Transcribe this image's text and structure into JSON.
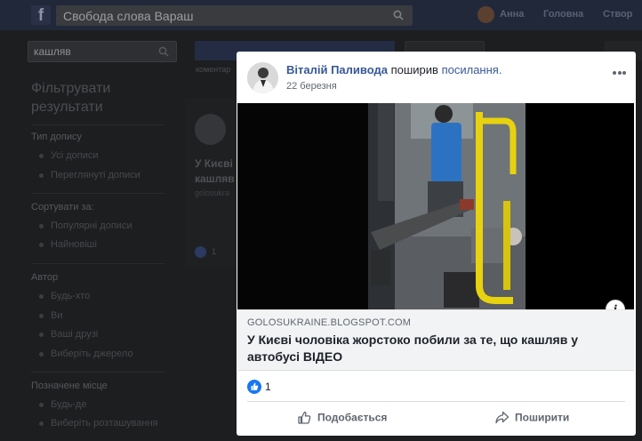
{
  "topbar": {
    "search_value": "Свобода слова Вараш",
    "user_name": "Анна",
    "nav_home": "Головна",
    "nav_create": "Створ"
  },
  "left_panel": {
    "search_value": "кашляв",
    "title": "Фільтрувати результати",
    "sections": [
      {
        "title": "Тип допису",
        "options": [
          "Усі дописи",
          "Переглянуті дописи"
        ]
      },
      {
        "title": "Сортувати за:",
        "options": [
          "Популярні дописи",
          "Найновіші"
        ]
      },
      {
        "title": "Автор",
        "options": [
          "Будь-хто",
          "Ви",
          "Ваші друзі",
          "Виберіть джерело"
        ]
      },
      {
        "title": "Позначене місце",
        "options": [
          "Будь-де",
          "Виберіть розташування"
        ]
      }
    ]
  },
  "feed": {
    "small_text": "коментар",
    "title_line1": "У Києві",
    "title_line2": "кашляв",
    "source": "golosukra",
    "like_count": "1"
  },
  "post": {
    "author": "Віталій Паливода",
    "action_text": "поширив",
    "link_word": "посилання.",
    "date": "22 березня",
    "link_domain": "GOLOSUKRAINE.BLOGSPOT.COM",
    "link_title": "У Києві чоловіка жорстоко побили за те, що кашляв у автобусі ВІДЕО",
    "info_glyph": "i",
    "like_count": "1",
    "like_label": "Подобається",
    "share_label": "Поширити"
  },
  "colors": {
    "facebook_blue": "#1877f2",
    "link_blue": "#385898"
  }
}
